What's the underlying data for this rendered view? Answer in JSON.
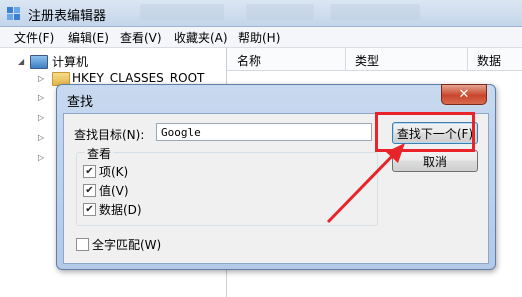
{
  "window": {
    "title": "注册表编辑器",
    "icon": "regedit-icon"
  },
  "menubar": {
    "items": [
      "文件(F)",
      "编辑(E)",
      "查看(V)",
      "收藏夹(A)",
      "帮助(H)"
    ]
  },
  "tree": {
    "root": "计算机",
    "first_key": "HKEY_CLASSES_ROOT"
  },
  "columns": [
    "名称",
    "类型",
    "数据"
  ],
  "dialog": {
    "title": "查找",
    "close": "✕",
    "find_label": "查找目标(N):",
    "find_value": "Google",
    "find_next_label": "查找下一个(F)",
    "cancel_label": "取消",
    "look_at": {
      "title": "查看",
      "options": [
        {
          "label": "项(K)",
          "checked": true
        },
        {
          "label": "值(V)",
          "checked": true
        },
        {
          "label": "数据(D)",
          "checked": true
        }
      ]
    },
    "match_whole": {
      "label": "全字匹配(W)",
      "checked": false
    }
  },
  "annotation": {
    "color": "#e8242a"
  }
}
